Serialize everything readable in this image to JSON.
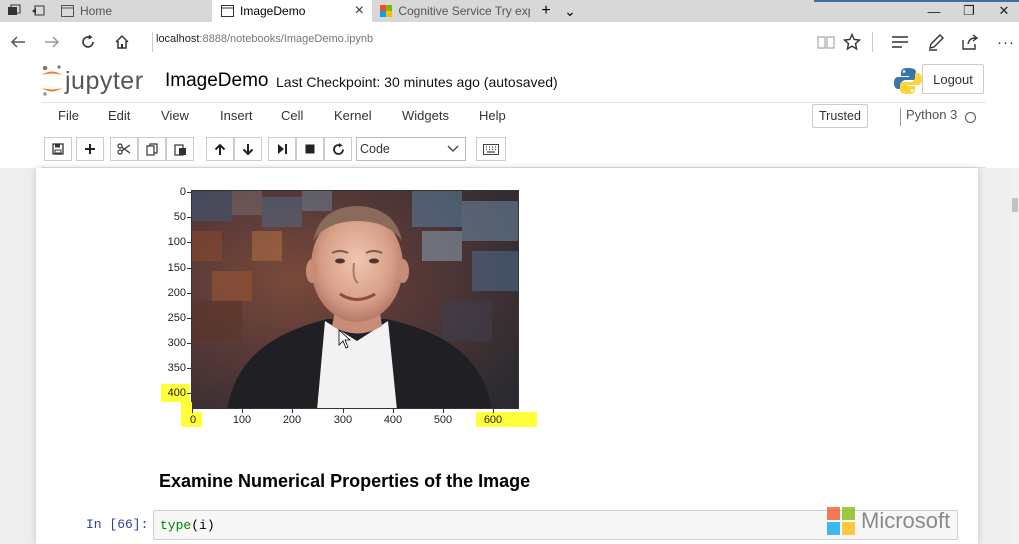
{
  "browser": {
    "tabs": [
      {
        "label": "Home"
      },
      {
        "label": "ImageDemo",
        "close": "×"
      },
      {
        "label": "Cognitive Service Try experi"
      }
    ],
    "new_tab": "+",
    "tab_list": "⌄",
    "window": {
      "minimize": "—",
      "maximize": "❐",
      "close": "✕"
    },
    "url_host": "localhost",
    "url_rest": ":8888/notebooks/ImageDemo.ipynb",
    "more": "···"
  },
  "jupyter": {
    "logo_text": "jupyter",
    "notebook_title": "ImageDemo",
    "checkpoint": "Last Checkpoint: 30 minutes ago (autosaved)",
    "logout": "Logout"
  },
  "menu": {
    "items": [
      "File",
      "Edit",
      "View",
      "Insert",
      "Cell",
      "Kernel",
      "Widgets",
      "Help"
    ],
    "trusted": "Trusted",
    "kernel": "Python 3"
  },
  "toolbar": {
    "cell_type": "Code"
  },
  "notebook": {
    "plot": {
      "y_ticks": [
        "0",
        "50",
        "100",
        "150",
        "200",
        "250",
        "300",
        "350",
        "400"
      ],
      "x_ticks": [
        "0",
        "100",
        "200",
        "300",
        "400",
        "500",
        "600"
      ],
      "highlighted_ticks": [
        "400",
        "0",
        "600"
      ]
    },
    "section_heading": "Examine Numerical Properties of the Image",
    "cell_prompt": "In [66]:",
    "code_fn": "type",
    "code_args": "(i)"
  },
  "watermark": {
    "text": "Microsoft"
  },
  "colors": {
    "highlight": "#ffff3a",
    "prompt_in": "#303f9f",
    "code_builtin": "#008000",
    "ms_red": "#f25022",
    "ms_green": "#7fba00",
    "ms_blue": "#00a4ef",
    "ms_yellow": "#ffb900"
  }
}
